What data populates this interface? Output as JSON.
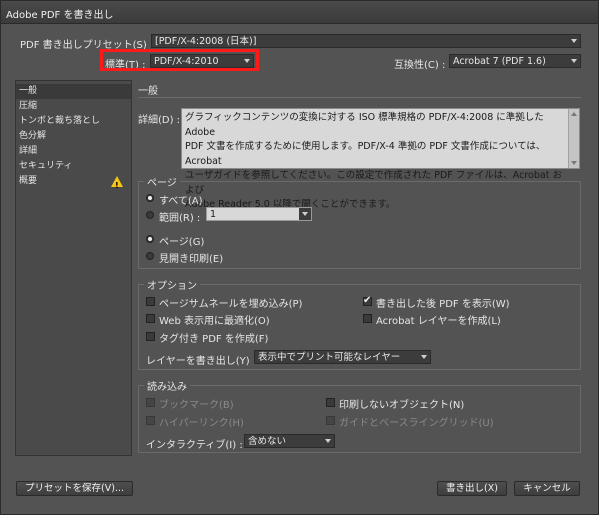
{
  "window": {
    "title": "Adobe PDF を書き出し"
  },
  "preset": {
    "label": "PDF 書き出しプリセット(S) :",
    "value": "[PDF/X-4:2008 (日本)]"
  },
  "standard": {
    "label": "標準(T) :",
    "value": "PDF/X-4:2010"
  },
  "compat": {
    "label": "互換性(C) :",
    "value": "Acrobat 7 (PDF 1.6)"
  },
  "sidebar": {
    "items": [
      {
        "label": "一般"
      },
      {
        "label": "圧縮"
      },
      {
        "label": "トンボと裁ち落とし"
      },
      {
        "label": "色分解"
      },
      {
        "label": "詳細"
      },
      {
        "label": "セキュリティ"
      },
      {
        "label": "概要"
      }
    ],
    "warn_mark": "!"
  },
  "general": {
    "title": "一般",
    "desc_label": "詳細(D) :",
    "desc_lines": [
      "グラフィックコンテンツの変換に対する ISO 標準規格の PDF/X-4:2008 に準拠した Adobe",
      "PDF 文書を作成するために使用します。PDF/X-4 準拠の PDF 文書作成については、Acrobat",
      "ユーザガイドを参照してください。この設定で作成された PDF ファイルは、Acrobat および",
      "Adobe Reader 5.0 以降で開くことができます。"
    ]
  },
  "pages": {
    "title": "ページ",
    "all": "すべて(A)",
    "range": "範囲(R) :",
    "range_value": "1",
    "page": "ページ(G)",
    "spread": "見開き印刷(E)"
  },
  "options": {
    "title": "オプション",
    "embed_thumbs": "ページサムネールを埋め込み(P)",
    "optimize_web": "Web 表示用に最適化(O)",
    "tagged_pdf": "タグ付き PDF を作成(F)",
    "view_after": "書き出した後 PDF を表示(W)",
    "acrobat_layers": "Acrobat レイヤーを作成(L)",
    "export_layers_label": "レイヤーを書き出し(Y) :",
    "export_layers_value": "表示中でプリント可能なレイヤー"
  },
  "include": {
    "title": "読み込み",
    "bookmarks": "ブックマーク(B)",
    "hyperlinks": "ハイパーリンク(H)",
    "nonprinting": "印刷しないオブジェクト(N)",
    "guides": "ガイドとベースライングリッド(U)",
    "interactive_label": "インタラクティブ(I) :",
    "interactive_value": "含めない"
  },
  "buttons": {
    "save_preset": "プリセットを保存(V)...",
    "export": "書き出し(X)",
    "cancel": "キャンセル"
  },
  "colors": {
    "highlight": "#ff1a1a",
    "warning": "#f5c518"
  }
}
